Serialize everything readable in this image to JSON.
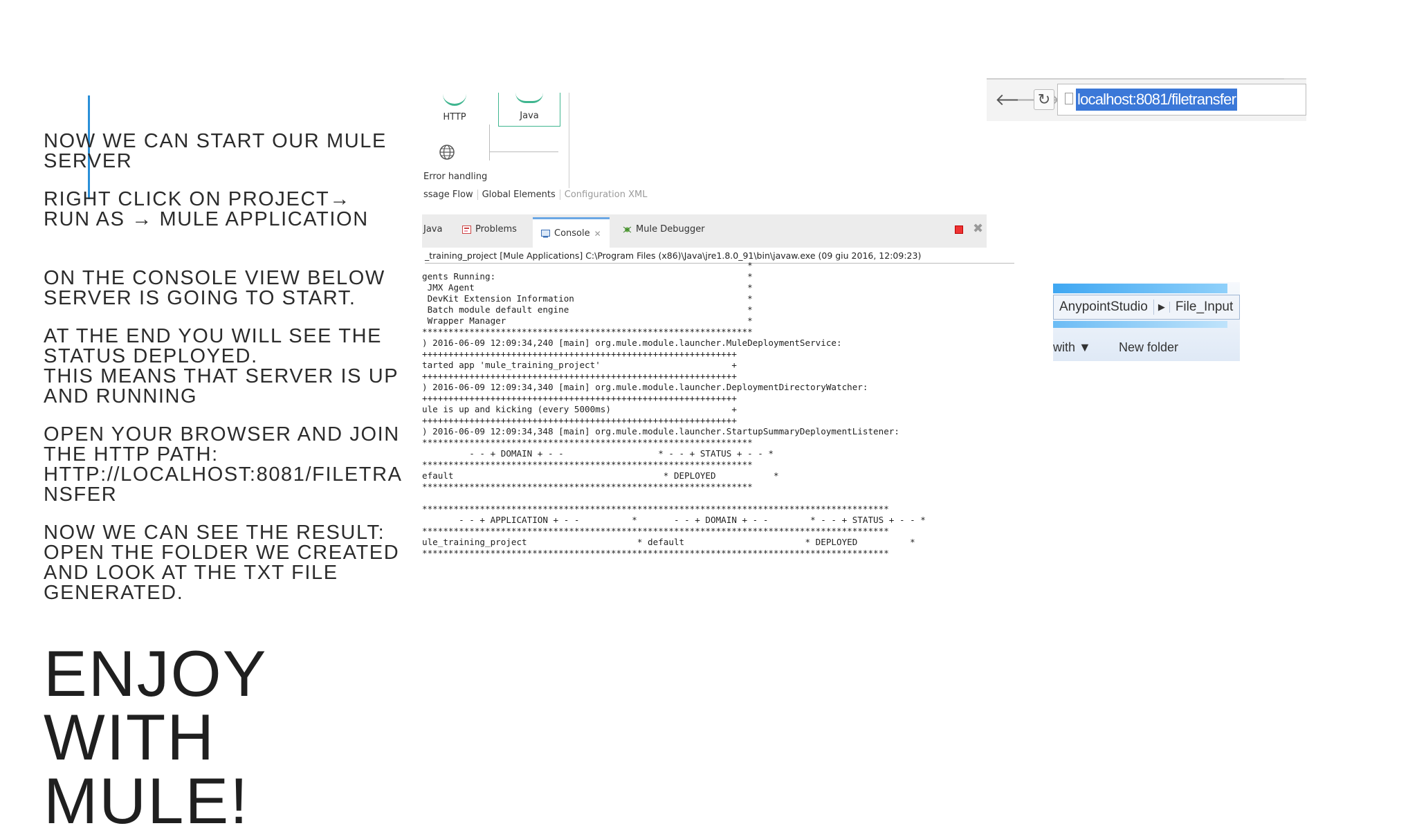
{
  "instructions": [
    [
      "NOW WE CAN START OUR MULE",
      "SERVER"
    ],
    [
      "RIGHT CLICK ON PROJECT→",
      "RUN AS → MULE APPLICATION"
    ],
    [
      "ON THE CONSOLE VIEW BELOW",
      "SERVER IS GOING TO START."
    ],
    [
      "AT THE END YOU WILL SEE THE",
      "STATUS DEPLOYED.",
      "THIS MEANS THAT SERVER IS UP",
      "AND RUNNING"
    ],
    [
      "OPEN YOUR BROWSER AND JOIN",
      "THE HTTP PATH:",
      "HTTP://LOCALHOST:8081/FILETRA",
      "NSFER"
    ],
    [
      "NOW WE CAN SEE THE RESULT:",
      "OPEN THE FOLDER WE CREATED",
      "AND LOOK AT THE TXT FILE",
      "GENERATED."
    ]
  ],
  "closing": [
    "ENJOY",
    "WITH",
    "MULE!"
  ],
  "studio": {
    "nodes": {
      "http": "HTTP",
      "java": "Java"
    },
    "error_handling": "Error handling",
    "canvas_tabs": [
      "ssage Flow",
      "Global Elements",
      "Configuration XML"
    ],
    "view_tabs": [
      "Java",
      "Problems",
      "Console",
      "Mule Debugger"
    ],
    "console_header": "_training_project [Mule Applications] C:\\Program Files (x86)\\Java\\jre1.8.0_91\\bin\\javaw.exe (09 giu 2016, 12:09:23)",
    "console_lines": [
      "                                                              *",
      "gents Running:                                                *",
      " JMX Agent                                                    *",
      " DevKit Extension Information                                 *",
      " Batch module default engine                                  *",
      " Wrapper Manager                                              *",
      "***************************************************************",
      ") 2016-06-09 12:09:34,240 [main] org.mule.module.launcher.MuleDeploymentService:",
      "++++++++++++++++++++++++++++++++++++++++++++++++++++++++++++",
      "tarted app 'mule_training_project'                         +",
      "++++++++++++++++++++++++++++++++++++++++++++++++++++++++++++",
      ") 2016-06-09 12:09:34,340 [main] org.mule.module.launcher.DeploymentDirectoryWatcher:",
      "++++++++++++++++++++++++++++++++++++++++++++++++++++++++++++",
      "ule is up and kicking (every 5000ms)                       +",
      "++++++++++++++++++++++++++++++++++++++++++++++++++++++++++++",
      ") 2016-06-09 12:09:34,348 [main] org.mule.module.launcher.StartupSummaryDeploymentListener:",
      "***************************************************************",
      "         - - + DOMAIN + - -                  * - - + STATUS + - - *",
      "***************************************************************",
      "efault                                        * DEPLOYED           *",
      "***************************************************************",
      "",
      "*****************************************************************************************",
      "       - - + APPLICATION + - -          *       - - + DOMAIN + - -        * - - + STATUS + - - *",
      "*****************************************************************************************",
      "ule_training_project                     * default                       * DEPLOYED          *",
      "*****************************************************************************************"
    ]
  },
  "browser": {
    "url": "localhost:8081/filetransfer"
  },
  "explorer": {
    "crumbs": [
      "AnypointStudio",
      "File_Input"
    ],
    "toolbar_left": "with ▼",
    "new_folder": "New folder"
  },
  "colors": {
    "accent": "#2a8fd8",
    "mule_green": "#3fb58f",
    "url_highlight": "#3b78d8"
  }
}
